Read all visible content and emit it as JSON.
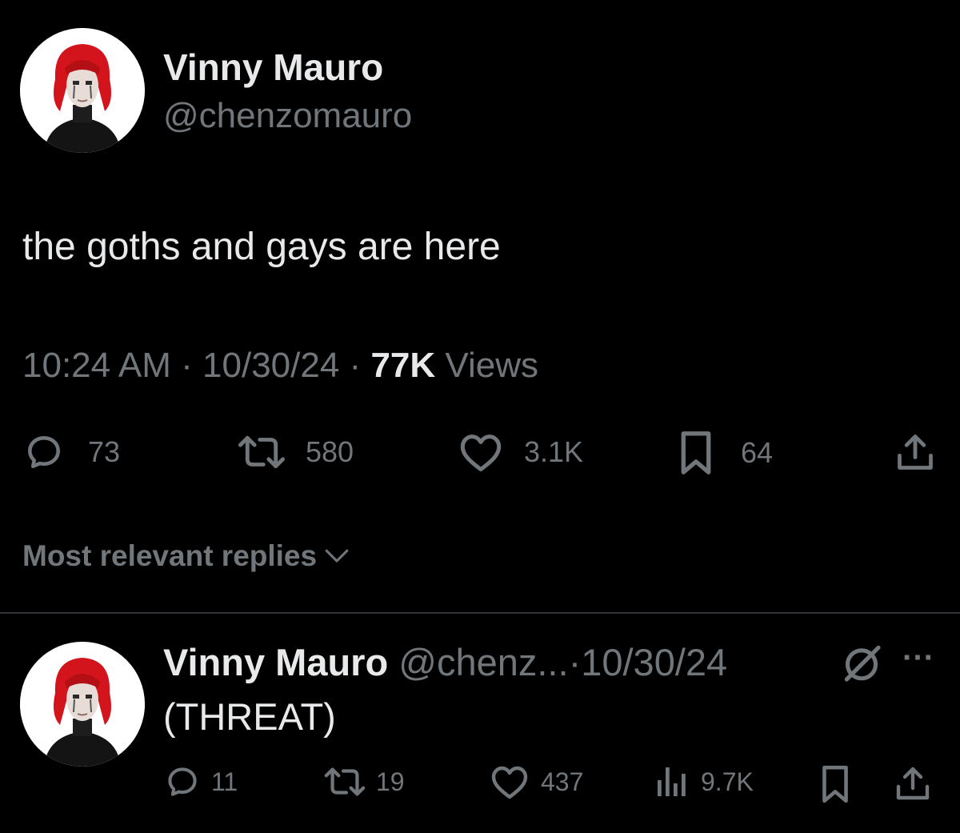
{
  "tweet": {
    "author_name": "Vinny Mauro",
    "author_handle": "@chenzomauro",
    "text": "the goths and gays are here",
    "time": "10:24 AM",
    "date": "10/30/24",
    "views_count": "77K",
    "views_label": "Views",
    "separator": "·",
    "actions": {
      "replies": "73",
      "reposts": "580",
      "likes": "3.1K",
      "bookmarks": "64"
    }
  },
  "replies_sort_label": "Most relevant replies",
  "reply": {
    "author_name": "Vinny Mauro",
    "author_handle": "@chenz...",
    "separator": "·",
    "date": "10/30/24",
    "text": "(THREAT)",
    "more_label": "···",
    "actions": {
      "replies": "11",
      "reposts": "19",
      "likes": "437",
      "views": "9.7K"
    }
  },
  "colors": {
    "background": "#000000",
    "primary_text": "#e7e9ea",
    "secondary_text": "#71767b",
    "divider": "#2f3336",
    "hair_red": "#d4141c"
  },
  "icons": {
    "reply": "speech-bubble-icon",
    "repost": "repost-arrows-icon",
    "like": "heart-icon",
    "bookmark": "bookmark-icon",
    "share": "share-upload-icon",
    "views": "bar-chart-icon",
    "grok": "slashed-circle-icon",
    "more": "more-dots-icon",
    "chevron": "chevron-down-icon"
  }
}
